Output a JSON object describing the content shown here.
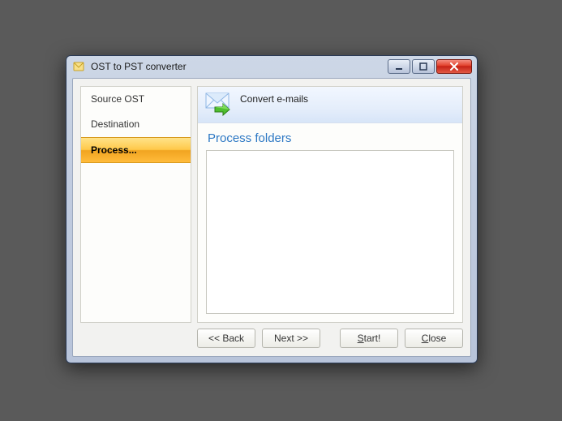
{
  "window": {
    "title": "OST to PST converter"
  },
  "sidebar": {
    "items": [
      {
        "label": "Source OST",
        "active": false
      },
      {
        "label": "Destination",
        "active": false
      },
      {
        "label": "Process...",
        "active": true
      }
    ]
  },
  "main": {
    "banner_title": "Convert e-mails",
    "section_title": "Process folders"
  },
  "footer": {
    "back": "<< Back",
    "next": "Next >>",
    "start_prefix": "S",
    "start_rest": "tart!",
    "close_prefix": "C",
    "close_rest": "lose"
  },
  "icons": {
    "app": "app-icon",
    "minimize": "minimize-icon",
    "maximize": "maximize-icon",
    "close": "close-icon",
    "envelope_arrow": "envelope-arrow-icon"
  }
}
